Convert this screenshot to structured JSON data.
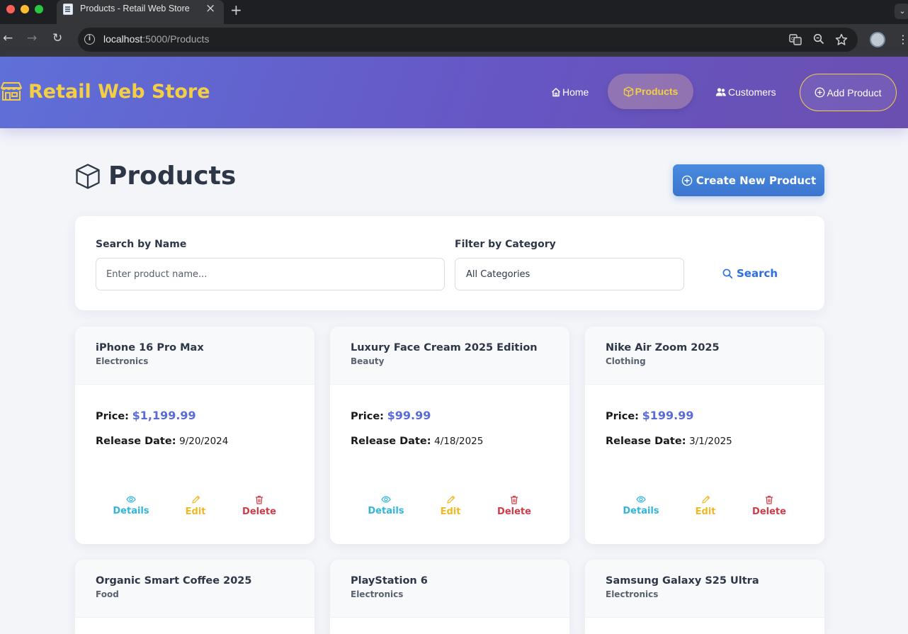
{
  "browser": {
    "tab_title": "Products - Retail Web Store",
    "url_host": "localhost",
    "url_path": ":5000/Products"
  },
  "header": {
    "brand": "Retail Web Store",
    "nav": {
      "home": "Home",
      "products": "Products",
      "customers": "Customers",
      "add_product": "Add Product"
    }
  },
  "main": {
    "title": "Products",
    "create_button": "Create New Product",
    "filters": {
      "search_label": "Search by Name",
      "search_placeholder": "Enter product name...",
      "search_value": "",
      "category_label": "Filter by Category",
      "category_selected": "All Categories",
      "search_button": "Search"
    },
    "labels": {
      "price": "Price:",
      "release_date": "Release Date:",
      "details": "Details",
      "edit": "Edit",
      "delete": "Delete"
    },
    "products": [
      {
        "name": "iPhone 16 Pro Max",
        "category": "Electronics",
        "price": "$1,199.99",
        "release_date": "9/20/2024"
      },
      {
        "name": "Luxury Face Cream 2025 Edition",
        "category": "Beauty",
        "price": "$99.99",
        "release_date": "4/18/2025"
      },
      {
        "name": "Nike Air Zoom 2025",
        "category": "Clothing",
        "price": "$199.99",
        "release_date": "3/1/2025"
      },
      {
        "name": "Organic Smart Coffee 2025",
        "category": "Food"
      },
      {
        "name": "PlayStation 6",
        "category": "Electronics"
      },
      {
        "name": "Samsung Galaxy S25 Ultra",
        "category": "Electronics"
      }
    ]
  },
  "colors": {
    "brand_yellow": "#f4cf45",
    "header_gradient_start": "#5f70d8",
    "header_gradient_end": "#6a4fb0",
    "price_blue": "#5a6bd8",
    "details_cyan": "#32b6de",
    "edit_yellow": "#f1b823",
    "delete_red": "#cf3c48",
    "primary_button": "#3b75cf"
  }
}
